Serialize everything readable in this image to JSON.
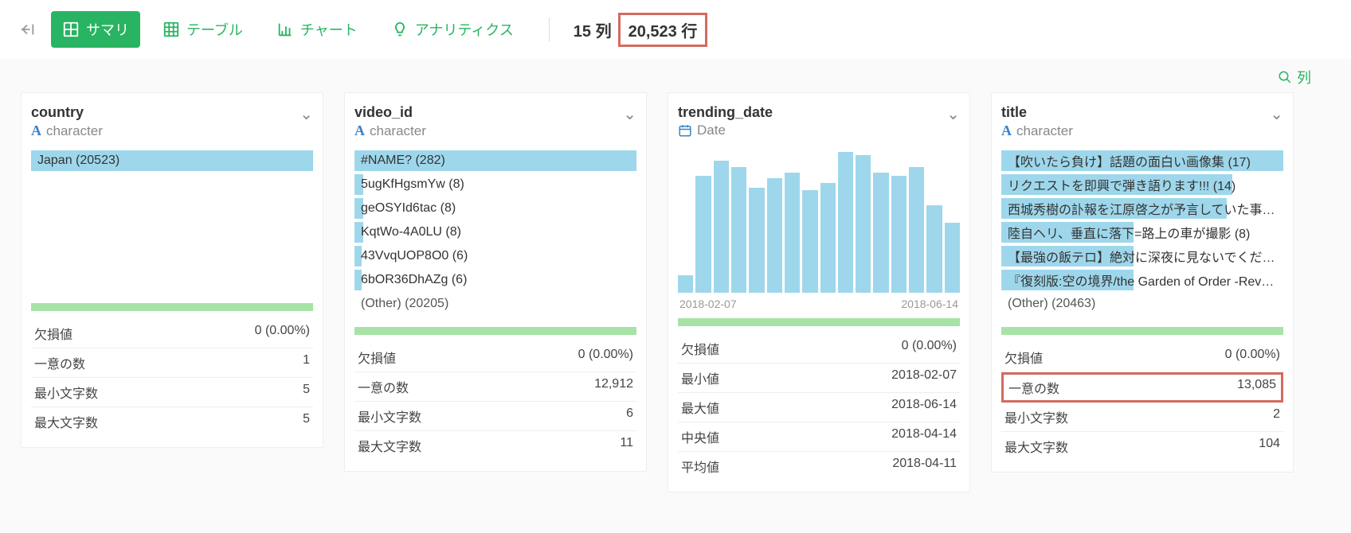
{
  "toolbar": {
    "tabs": [
      {
        "label": "サマリ",
        "active": true,
        "icon": "summary"
      },
      {
        "label": "テーブル",
        "active": false,
        "icon": "table"
      },
      {
        "label": "チャート",
        "active": false,
        "icon": "chart"
      },
      {
        "label": "アナリティクス",
        "active": false,
        "icon": "analytics"
      }
    ],
    "cols_label": "15 列",
    "rows_label": "20,523 行",
    "search_label": "列"
  },
  "cards": [
    {
      "name": "country",
      "type_label": "character",
      "type_icon": "A",
      "bars": [
        {
          "label": "Japan (20523)",
          "pct": 100
        }
      ],
      "other": null,
      "stats": [
        {
          "k": "欠損値",
          "v": "0 (0.00%)"
        },
        {
          "k": "一意の数",
          "v": "1"
        },
        {
          "k": "最小文字数",
          "v": "5"
        },
        {
          "k": "最大文字数",
          "v": "5"
        }
      ],
      "highlight_stat_index": -1
    },
    {
      "name": "video_id",
      "type_label": "character",
      "type_icon": "A",
      "bars": [
        {
          "label": "#NAME? (282)",
          "pct": 100
        },
        {
          "label": "5ugKfHgsmYw (8)",
          "pct": 3
        },
        {
          "label": "geOSYId6tac (8)",
          "pct": 3
        },
        {
          "label": "KqtWo-4A0LU (8)",
          "pct": 3
        },
        {
          "label": "43VvqUOP8O0 (6)",
          "pct": 2.5
        },
        {
          "label": "6bOR36DhAZg (6)",
          "pct": 2.5
        }
      ],
      "other": "(Other) (20205)",
      "stats": [
        {
          "k": "欠損値",
          "v": "0 (0.00%)"
        },
        {
          "k": "一意の数",
          "v": "12,912"
        },
        {
          "k": "最小文字数",
          "v": "6"
        },
        {
          "k": "最大文字数",
          "v": "11"
        }
      ],
      "highlight_stat_index": -1
    },
    {
      "name": "trending_date",
      "type_label": "Date",
      "type_icon": "date",
      "chart_data": {
        "type": "bar",
        "x_start": "2018-02-07",
        "x_end": "2018-06-14",
        "values": [
          12,
          80,
          90,
          86,
          72,
          78,
          82,
          70,
          75,
          96,
          94,
          82,
          80,
          86,
          60,
          48
        ]
      },
      "stats": [
        {
          "k": "欠損値",
          "v": "0 (0.00%)"
        },
        {
          "k": "最小値",
          "v": "2018-02-07"
        },
        {
          "k": "最大値",
          "v": "2018-06-14"
        },
        {
          "k": "中央値",
          "v": "2018-04-14"
        },
        {
          "k": "平均値",
          "v": "2018-04-11"
        }
      ],
      "highlight_stat_index": -1
    },
    {
      "name": "title",
      "type_label": "character",
      "type_icon": "A",
      "bars": [
        {
          "label": "【吹いたら負け】話題の面白い画像集 (17)",
          "pct": 100
        },
        {
          "label": "リクエストを即興で弾き語ります!!! (14)",
          "pct": 82
        },
        {
          "label": "西城秀樹の訃報を江原啓之が予言していた事…",
          "pct": 80
        },
        {
          "label": "陸自ヘリ、垂直に落下=路上の車が撮影 (8)",
          "pct": 47
        },
        {
          "label": "【最強の飯テロ】絶対に深夜に見ないでくだ…",
          "pct": 47
        },
        {
          "label": "『復刻版:空の境界/the Garden of Order -Rev…",
          "pct": 47
        }
      ],
      "other": "(Other) (20463)",
      "stats": [
        {
          "k": "欠損値",
          "v": "0 (0.00%)"
        },
        {
          "k": "一意の数",
          "v": "13,085"
        },
        {
          "k": "最小文字数",
          "v": "2"
        },
        {
          "k": "最大文字数",
          "v": "104"
        }
      ],
      "highlight_stat_index": 1
    }
  ]
}
